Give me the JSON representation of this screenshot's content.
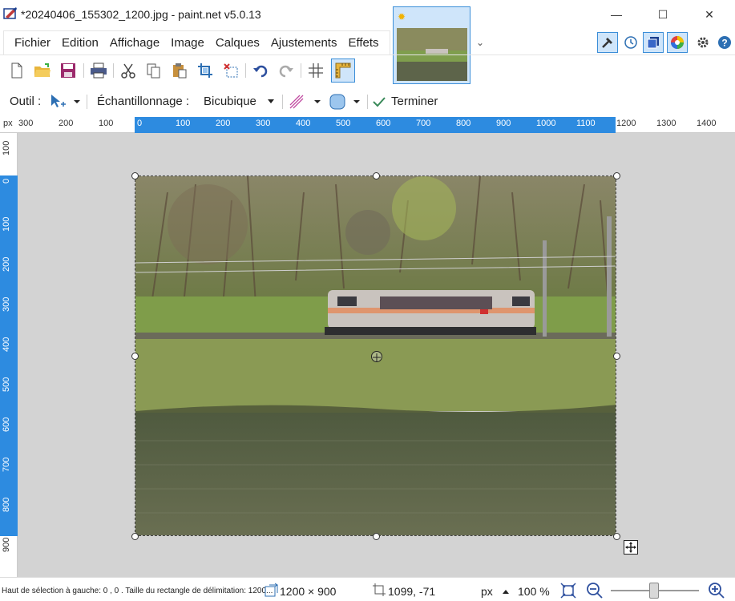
{
  "window": {
    "title": "*20240406_155302_1200.jpg - paint.net v5.0.13",
    "minimize": "—",
    "maximize": "☐",
    "close": "✕"
  },
  "menu": {
    "items": [
      "Fichier",
      "Edition",
      "Affichage",
      "Image",
      "Calques",
      "Ajustements",
      "Effets"
    ]
  },
  "tool_options": {
    "tool_label": "Outil :",
    "sampling_label": "Échantillonnage :",
    "sampling_value": "Bicubique",
    "finish_label": "Terminer"
  },
  "ruler": {
    "unit": "px",
    "h_ticks": [
      "300",
      "200",
      "100",
      "0",
      "100",
      "200",
      "300",
      "400",
      "500",
      "600",
      "700",
      "800",
      "900",
      "1000",
      "1100",
      "1200",
      "1300",
      "1400"
    ],
    "v_ticks": [
      "100",
      "0",
      "100",
      "200",
      "300",
      "400",
      "500",
      "600",
      "700",
      "800",
      "900"
    ]
  },
  "status": {
    "hint": "Haut de sélection à gauche: 0 , 0 . Taille du rectangle de délimitation: 1200...",
    "image_size": "1200 × 900",
    "cursor_pos": "1099, -71",
    "unit": "px",
    "zoom": "100 %"
  },
  "colors": {
    "accent": "#2d8be0",
    "canvas_bg": "#d3d3d3"
  },
  "icons": {
    "app": "paintnet-icon",
    "new": "new-file-icon",
    "open": "open-folder-icon",
    "save": "save-icon",
    "print": "print-icon",
    "cut": "cut-icon",
    "copy": "copy-icon",
    "paste": "paste-icon",
    "crop": "crop-icon",
    "deselect": "deselect-icon",
    "undo": "undo-icon",
    "redo": "redo-icon",
    "grid": "grid-icon",
    "rulers": "ruler-icon",
    "tools": "tools-icon",
    "history": "history-icon",
    "layers": "layers-icon",
    "colors": "colors-icon",
    "settings": "gear-icon",
    "help": "help-icon"
  }
}
